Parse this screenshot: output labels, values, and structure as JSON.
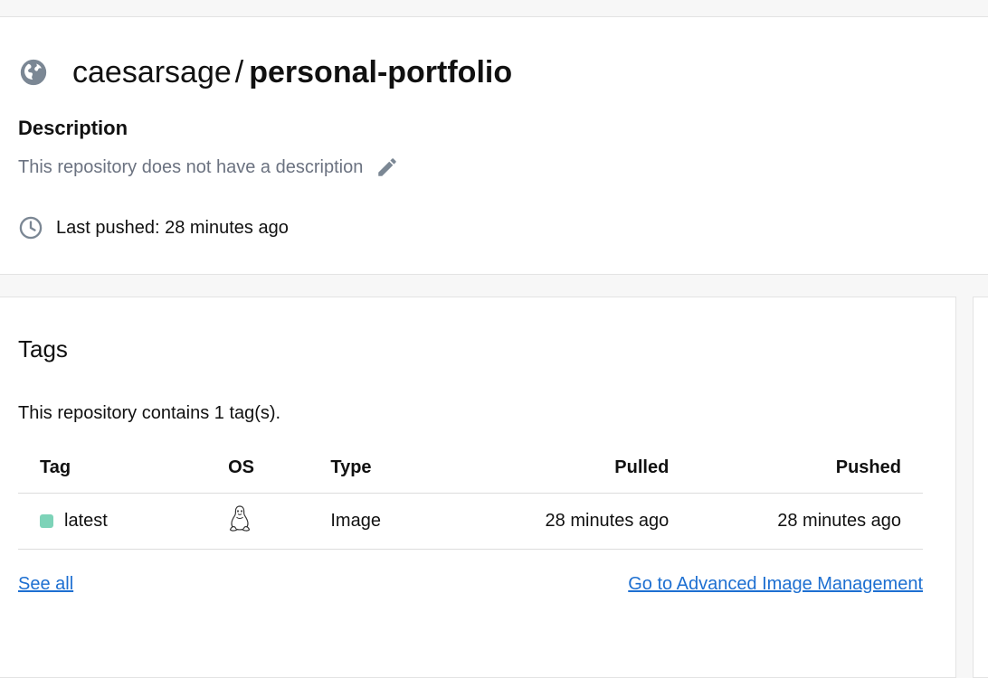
{
  "repo": {
    "owner": "caesarsage",
    "separator": "/",
    "name": "personal-portfolio"
  },
  "description": {
    "heading": "Description",
    "text": "This repository does not have a description"
  },
  "last_pushed": {
    "text": "Last pushed: 28 minutes ago"
  },
  "tags": {
    "heading": "Tags",
    "count_text": "This repository contains 1 tag(s).",
    "columns": {
      "tag": "Tag",
      "os": "OS",
      "type": "Type",
      "pulled": "Pulled",
      "pushed": "Pushed"
    },
    "rows": [
      {
        "tag": "latest",
        "os_icon": "linux-icon",
        "type": "Image",
        "pulled": "28 minutes ago",
        "pushed": "28 minutes ago",
        "status_color": "#7dd3b8"
      }
    ],
    "see_all": "See all",
    "advanced_link": "Go to Advanced Image Management"
  },
  "colors": {
    "link": "#1d6fd1",
    "muted_text": "#6b7280",
    "icon_gray": "#7b8794",
    "status_green": "#7dd3b8"
  },
  "icons": {
    "visibility": "globe-icon",
    "edit": "pencil-icon",
    "time": "clock-icon"
  }
}
